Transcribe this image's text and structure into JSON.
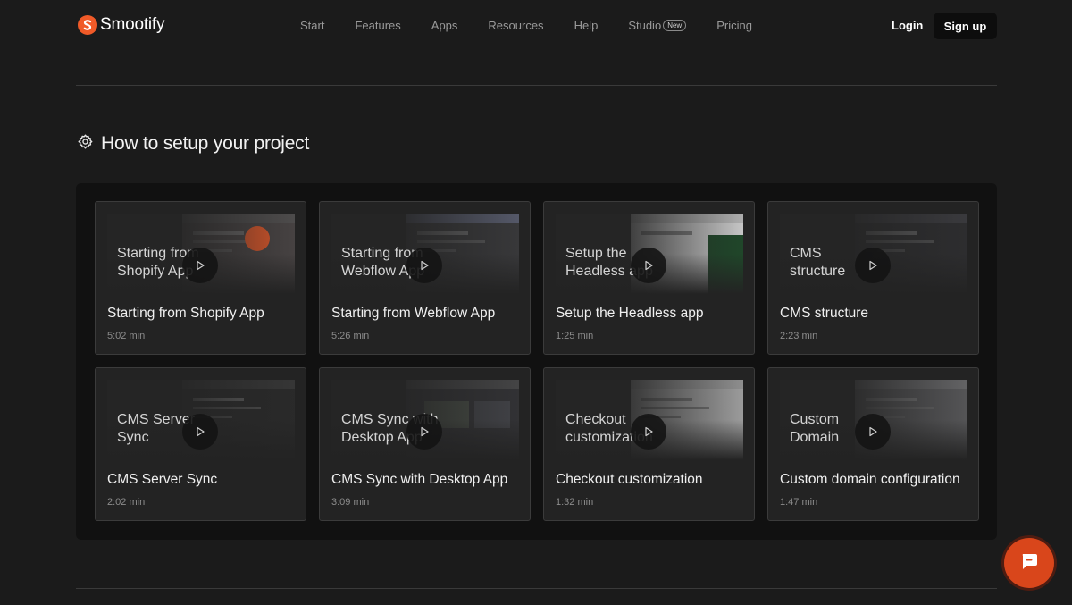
{
  "brand": {
    "name": "Smootify"
  },
  "nav": {
    "links": [
      {
        "label": "Start"
      },
      {
        "label": "Features"
      },
      {
        "label": "Apps"
      },
      {
        "label": "Resources"
      },
      {
        "label": "Help"
      },
      {
        "label": "Studio",
        "badge": "New"
      },
      {
        "label": "Pricing"
      }
    ],
    "login_label": "Login",
    "signup_label": "Sign up"
  },
  "section": {
    "title": "How to setup your project",
    "icon": "gear-icon"
  },
  "videos": [
    {
      "thumb_title": "Starting from\nShopify App",
      "title": "Starting from Shopify App",
      "duration": "5:02 min"
    },
    {
      "thumb_title": "Starting from\nWebflow App",
      "title": "Starting from Webflow App",
      "duration": "5:26 min"
    },
    {
      "thumb_title": "Setup the\nHeadless app",
      "title": "Setup the Headless app",
      "duration": "1:25 min"
    },
    {
      "thumb_title": "CMS\nstructure",
      "title": "CMS structure",
      "duration": "2:23 min"
    },
    {
      "thumb_title": "CMS Server\nSync",
      "title": "CMS Server Sync",
      "duration": "2:02 min"
    },
    {
      "thumb_title": "CMS Sync with\nDesktop App",
      "title": "CMS Sync with Desktop App",
      "duration": "3:09 min"
    },
    {
      "thumb_title": "Checkout\ncustomization",
      "title": "Checkout customization",
      "duration": "1:32 min"
    },
    {
      "thumb_title": "Custom\nDomain",
      "title": "Custom domain configuration",
      "duration": "1:47 min"
    }
  ],
  "colors": {
    "accent": "#f05a28",
    "chat_button": "#d9461b",
    "background": "#1b1b1b"
  }
}
